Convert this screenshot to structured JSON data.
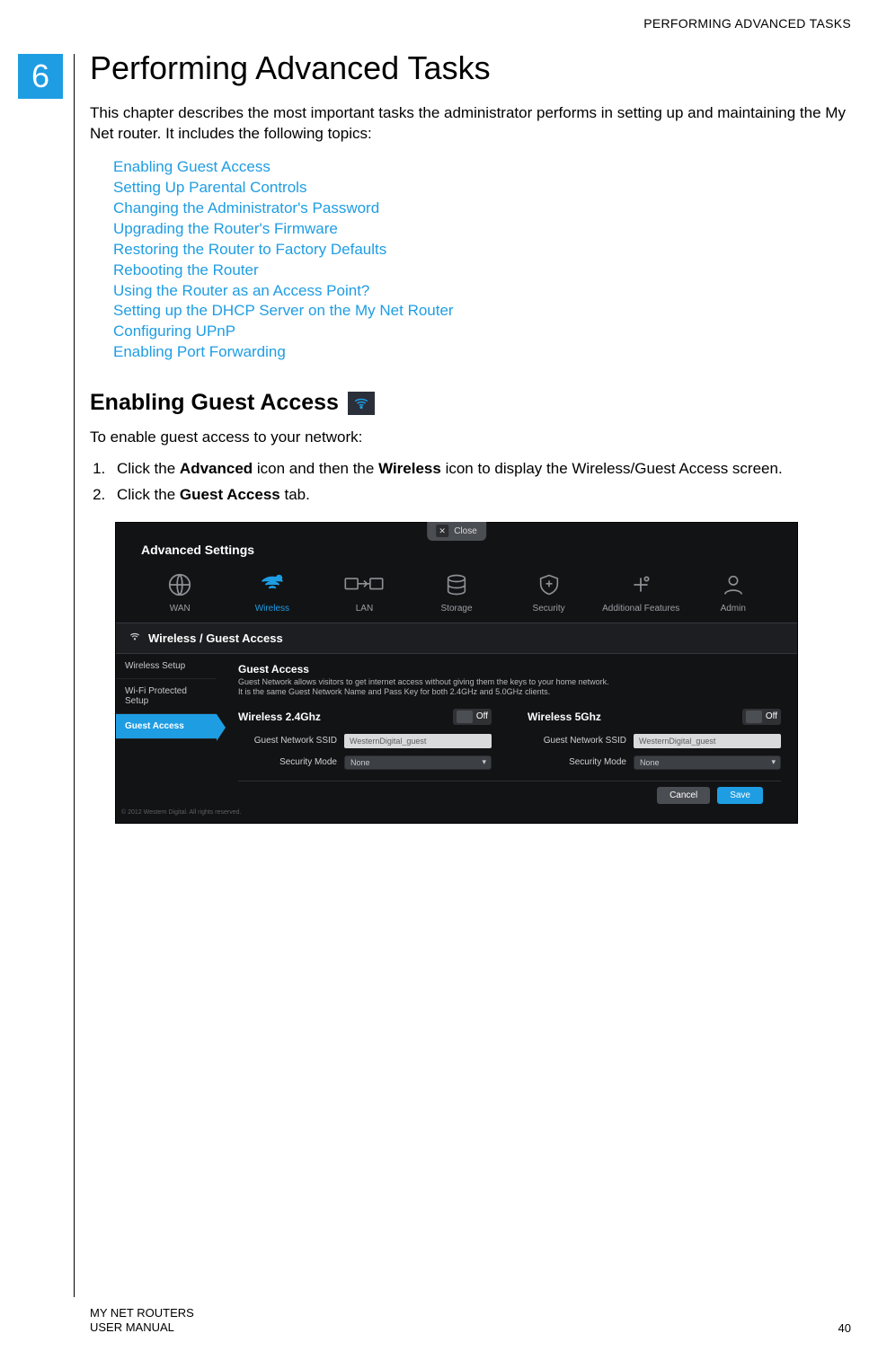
{
  "header": {
    "running": "PERFORMING ADVANCED TASKS"
  },
  "chapter": {
    "number": "6",
    "title": "Performing Advanced Tasks"
  },
  "intro": "This chapter describes the most important tasks the administrator performs in setting up and maintaining the My Net router. It includes the following topics:",
  "toc": [
    "Enabling Guest Access",
    "Setting Up Parental Controls",
    "Changing the Administrator's Password",
    "Upgrading the Router's Firmware",
    "Restoring the Router to Factory Defaults",
    "Rebooting the Router",
    "Using the Router as an Access Point?",
    "Setting up the DHCP Server on the My Net Router",
    "Configuring UPnP",
    "Enabling Port Forwarding"
  ],
  "section": {
    "title": "Enabling Guest Access",
    "lead": "To enable guest access to your network:",
    "steps_html": {
      "s1_a": "Click the ",
      "s1_b": "Advanced",
      "s1_c": " icon and then the ",
      "s1_d": "Wireless",
      "s1_e": " icon to display the Wireless/Guest Access screen.",
      "s2_a": "Click the ",
      "s2_b": "Guest Access",
      "s2_c": " tab."
    }
  },
  "panel": {
    "close": "Close",
    "title": "Advanced Settings",
    "nav": [
      "WAN",
      "Wireless",
      "LAN",
      "Storage",
      "Security",
      "Additional Features",
      "Admin"
    ],
    "nav_active_index": 1,
    "breadcrumb": "Wireless / Guest Access",
    "side_tabs": [
      "Wireless Setup",
      "Wi-Fi Protected Setup",
      "Guest Access"
    ],
    "side_active_index": 2,
    "form": {
      "title": "Guest Access",
      "desc1": "Guest Network allows visitors to get internet access without giving them the keys to your home network.",
      "desc2": "It is the same Guest Network Name and Pass Key for both 2.4GHz and 5.0GHz clients.",
      "cols": [
        {
          "head": "Wireless 2.4Ghz",
          "toggle": "Off",
          "ssid_label": "Guest Network SSID",
          "ssid_value": "WesternDigital_guest",
          "mode_label": "Security Mode",
          "mode_value": "None"
        },
        {
          "head": "Wireless 5Ghz",
          "toggle": "Off",
          "ssid_label": "Guest Network SSID",
          "ssid_value": "WesternDigital_guest",
          "mode_label": "Security Mode",
          "mode_value": "None"
        }
      ],
      "cancel": "Cancel",
      "save": "Save"
    },
    "copyright": "© 2012 Western Digital. All rights reserved."
  },
  "footer": {
    "line1": "MY NET ROUTERS",
    "line2": "USER MANUAL",
    "page": "40"
  }
}
